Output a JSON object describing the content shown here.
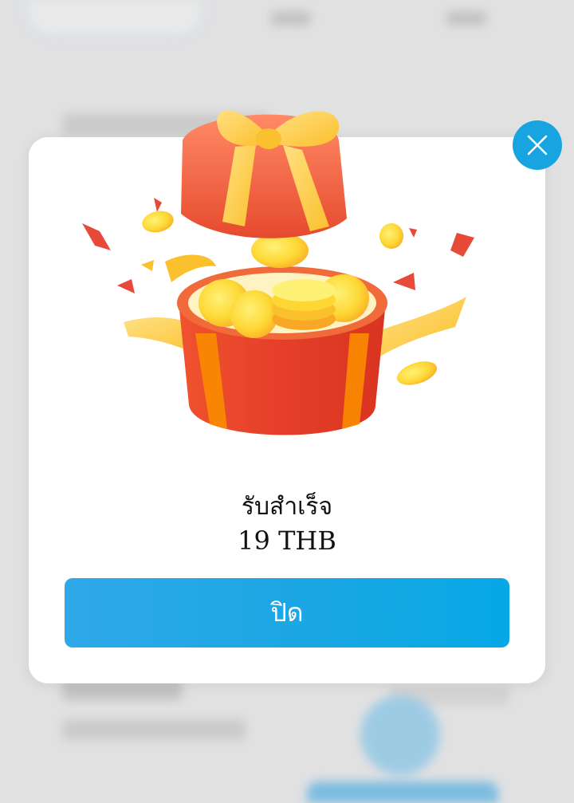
{
  "modal": {
    "title": "รับสำเร็จ",
    "amount": "19 THB",
    "close_button_label": "ปิด",
    "close_icon": "close-icon",
    "illustration_icon": "gift-box-coins-icon"
  },
  "colors": {
    "accent": "#17a4e0",
    "button_start": "#2fa8e8",
    "button_end": "#07a8e6",
    "gift_red": "#e8412a",
    "ribbon_gold": "#fbc02d",
    "coin_gold": "#fdd835"
  }
}
